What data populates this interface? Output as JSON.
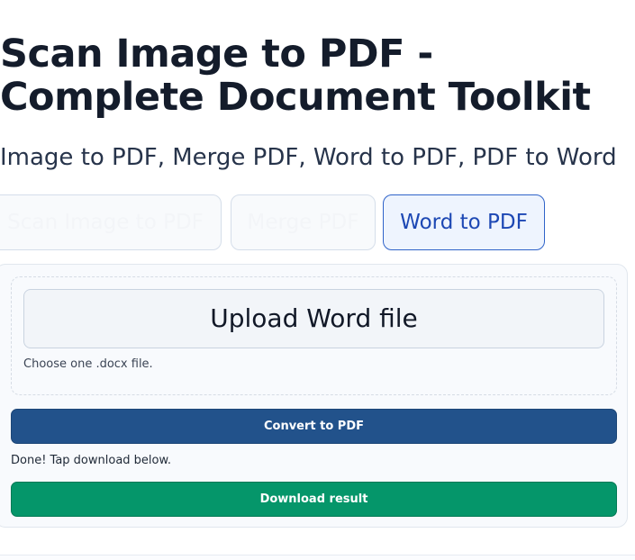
{
  "header": {
    "title": "Scan Image to PDF - Complete Document Toolkit",
    "subtitle": "Image to PDF, Merge PDF, Word to PDF, PDF to Word"
  },
  "tabs": [
    {
      "label": "Scan Image to PDF",
      "active": false
    },
    {
      "label": "Merge PDF",
      "active": false
    },
    {
      "label": "Word to PDF",
      "active": true
    }
  ],
  "panel": {
    "upload_label": "Upload Word file",
    "hint": "Choose one .docx file.",
    "convert_label": "Convert to PDF",
    "status": "Done! Tap download below.",
    "download_label": "Download result"
  },
  "colors": {
    "active_tab": "#1d48b4",
    "convert_button": "#22528b",
    "download_button": "#05966a"
  }
}
